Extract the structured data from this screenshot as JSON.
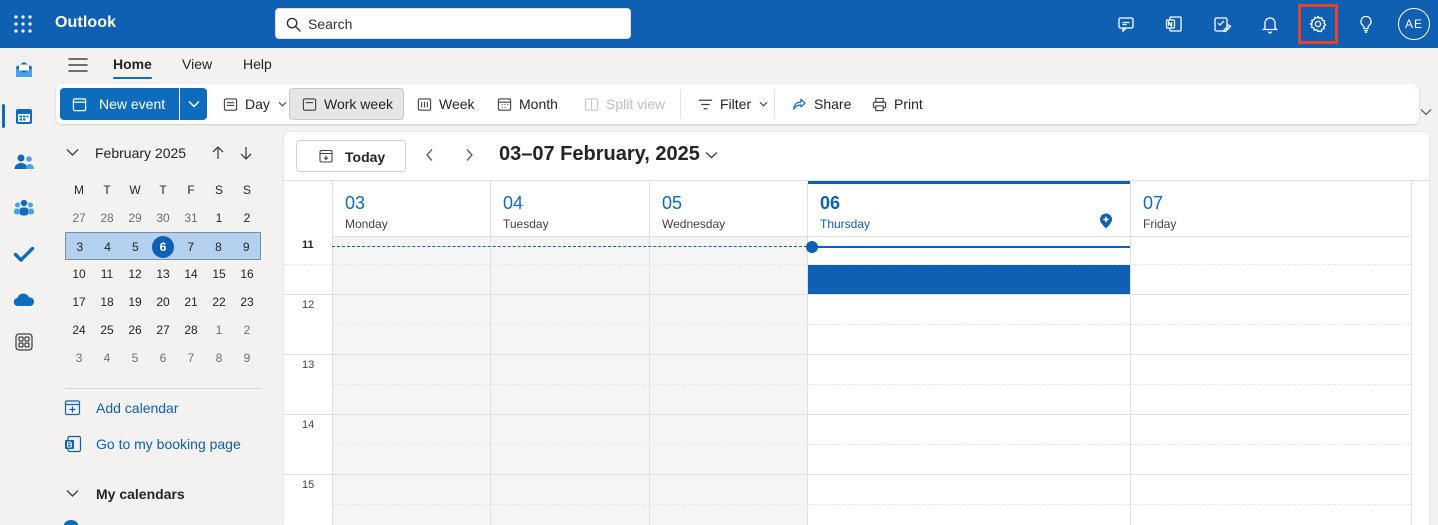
{
  "app": {
    "title": "Outlook"
  },
  "search": {
    "placeholder": "Search"
  },
  "header": {
    "icons": [
      "meet-now-icon",
      "onenote-icon",
      "my-day-icon",
      "notifications-icon",
      "settings-icon",
      "tips-icon"
    ],
    "avatar_initials": "AE",
    "highlight_color": "#e0442c"
  },
  "rail": [
    "mail-icon",
    "calendar-icon",
    "people-icon",
    "groups-icon",
    "todo-icon",
    "onedrive-icon",
    "more-apps-icon"
  ],
  "ribbon": {
    "tabs": [
      {
        "label": "Home",
        "active": true
      },
      {
        "label": "View"
      },
      {
        "label": "Help"
      }
    ],
    "new_event": "New event",
    "day": "Day",
    "work_week": "Work week",
    "week": "Week",
    "month": "Month",
    "split_view": "Split view",
    "filter": "Filter",
    "share": "Share",
    "print": "Print"
  },
  "mini_calendar": {
    "title": "February 2025",
    "weekdays": [
      "M",
      "T",
      "W",
      "T",
      "F",
      "S",
      "S"
    ],
    "weeks": [
      [
        "27",
        "28",
        "29",
        "30",
        "31",
        "1",
        "2"
      ],
      [
        "3",
        "4",
        "5",
        "6",
        "7",
        "8",
        "9"
      ],
      [
        "10",
        "11",
        "12",
        "13",
        "14",
        "15",
        "16"
      ],
      [
        "17",
        "18",
        "19",
        "20",
        "21",
        "22",
        "23"
      ],
      [
        "24",
        "25",
        "26",
        "27",
        "28",
        "1",
        "2"
      ],
      [
        "3",
        "4",
        "5",
        "6",
        "7",
        "8",
        "9"
      ]
    ],
    "today": "6"
  },
  "left_links": {
    "add_calendar": "Add calendar",
    "booking_page": "Go to my booking page",
    "my_calendars": "My calendars"
  },
  "calendar": {
    "today_button": "Today",
    "range_title": "03–07 February, 2025",
    "days": [
      {
        "num": "03",
        "name": "Monday"
      },
      {
        "num": "04",
        "name": "Tuesday"
      },
      {
        "num": "05",
        "name": "Wednesday"
      },
      {
        "num": "06",
        "name": "Thursday"
      },
      {
        "num": "07",
        "name": "Friday"
      }
    ],
    "hours": [
      "11",
      "12",
      "13",
      "14",
      "15"
    ],
    "accent": "#0f5fb3"
  }
}
